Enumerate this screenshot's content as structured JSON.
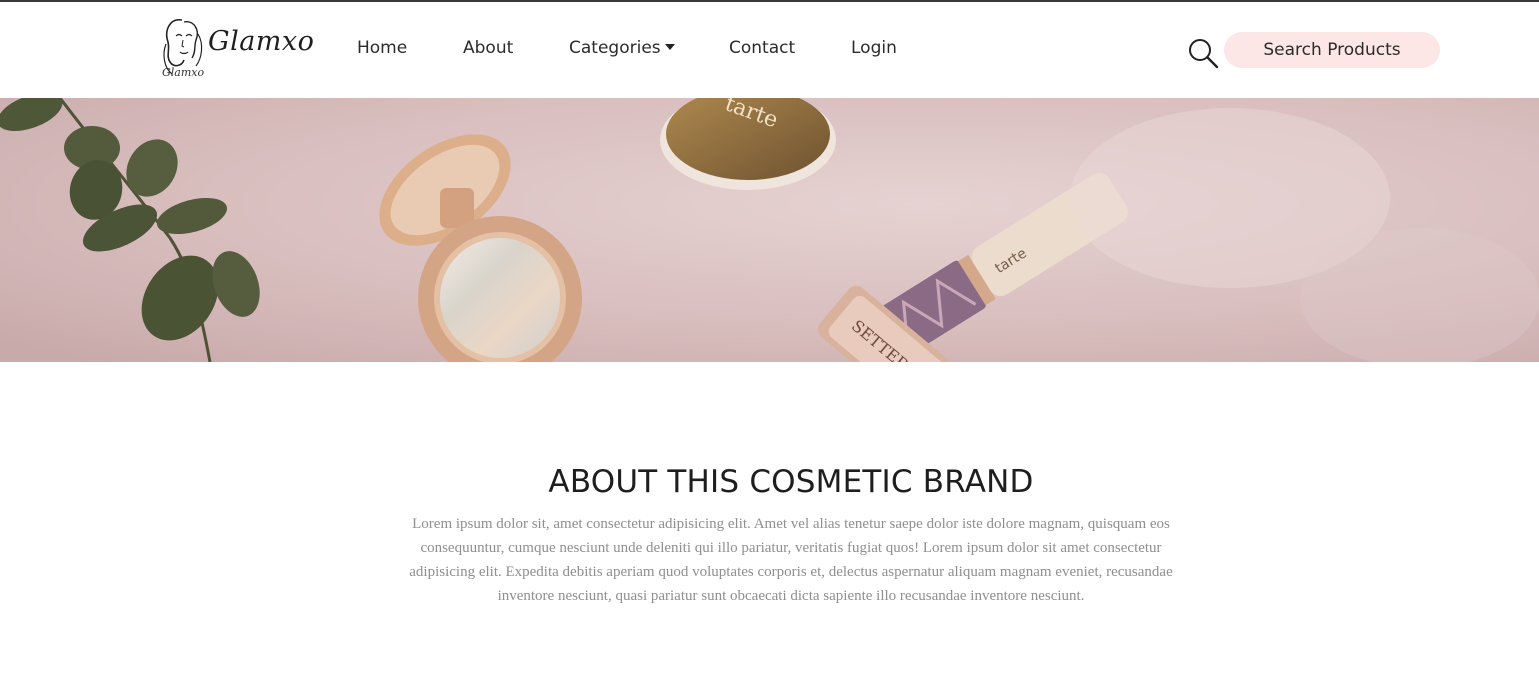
{
  "brand": {
    "name": "Glamxo",
    "small_name": "Glamxo"
  },
  "nav": {
    "items": [
      {
        "label": "Home"
      },
      {
        "label": "About"
      },
      {
        "label": "Categories"
      },
      {
        "label": "Contact"
      },
      {
        "label": "Login"
      }
    ]
  },
  "search": {
    "icon": "search-icon",
    "button_label": "Search Products"
  },
  "hero": {
    "compact_lid_text": "tarte",
    "concealer_text": "tarte",
    "setting_text": "SETTER"
  },
  "about": {
    "title": "ABOUT THIS COSMETIC BRAND",
    "body": "Lorem ipsum dolor sit, amet consectetur adipisicing elit. Amet vel alias tenetur saepe dolor iste dolore magnam, quisquam eos consequuntur, cumque nesciunt unde deleniti qui illo pariatur, veritatis fugiat quos! Lorem ipsum dolor sit amet consectetur adipisicing elit. Expedita debitis aperiam quod voluptates corporis et, delectus aspernatur aliquam magnam eveniet, recusandae inventore nesciunt, quasi pariatur sunt obcaecati dicta sapiente illo recusandae inventore nesciunt."
  },
  "colors": {
    "search_button_bg": "#fce6e6",
    "hero_bg": "#dcc3c3",
    "body_text": "#8f8f8f",
    "top_border": "#3a3a3a"
  }
}
